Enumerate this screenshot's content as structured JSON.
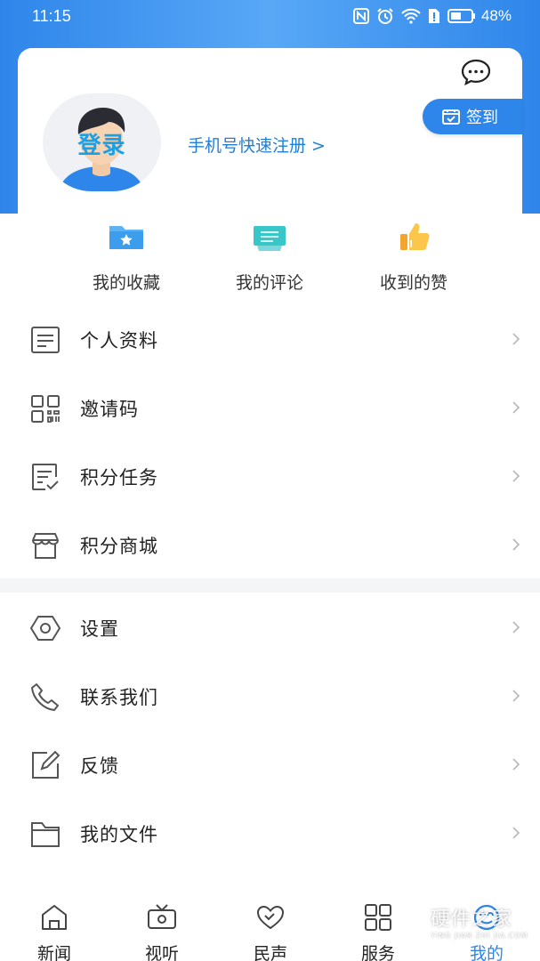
{
  "status_bar": {
    "time": "11:15",
    "battery": "48%"
  },
  "header": {
    "login_label": "登录",
    "register_link": "手机号快速注册 >",
    "checkin_label": "签到"
  },
  "quick_actions": [
    {
      "label": "我的收藏",
      "icon": "star-folder-icon"
    },
    {
      "label": "我的评论",
      "icon": "comment-icon"
    },
    {
      "label": "收到的赞",
      "icon": "thumbs-up-icon"
    }
  ],
  "menu_group_1": [
    {
      "label": "个人资料",
      "icon": "profile-doc-icon"
    },
    {
      "label": "邀请码",
      "icon": "qr-code-icon"
    },
    {
      "label": "积分任务",
      "icon": "task-list-icon"
    },
    {
      "label": "积分商城",
      "icon": "store-icon"
    }
  ],
  "menu_group_2": [
    {
      "label": "设置",
      "icon": "hexagon-settings-icon"
    },
    {
      "label": "联系我们",
      "icon": "phone-icon"
    },
    {
      "label": "反馈",
      "icon": "feedback-edit-icon"
    },
    {
      "label": "我的文件",
      "icon": "folder-icon"
    }
  ],
  "tabbar": [
    {
      "label": "新闻",
      "icon": "home-icon",
      "active": false
    },
    {
      "label": "视听",
      "icon": "tv-icon",
      "active": false
    },
    {
      "label": "民声",
      "icon": "heart-icon",
      "active": false
    },
    {
      "label": "服务",
      "icon": "grid-icon",
      "active": false
    },
    {
      "label": "我的",
      "icon": "user-icon",
      "active": true
    }
  ],
  "watermark": {
    "text": "硬件之家",
    "subtext": "YING JIAN ZHI JIA.COM"
  },
  "colors": {
    "accent": "#2f86ea",
    "link": "#1f7fd8",
    "divider": "#f4f5f7"
  }
}
